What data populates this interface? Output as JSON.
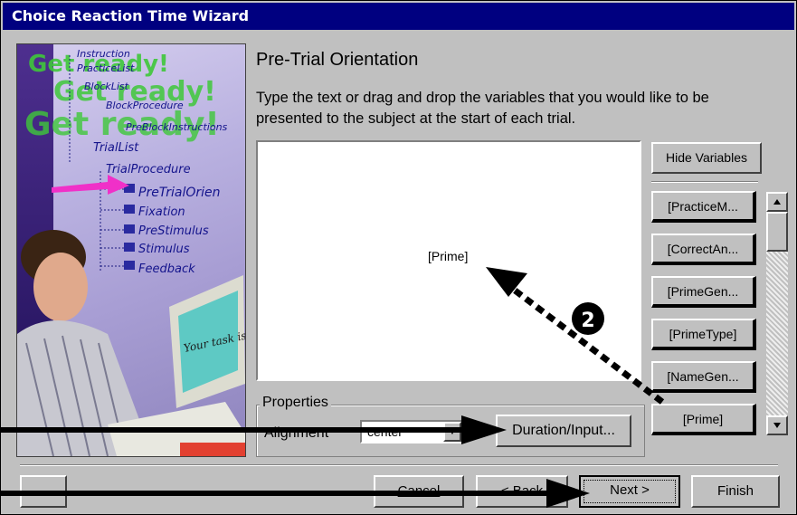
{
  "window": {
    "title": "Choice Reaction Time Wizard"
  },
  "illustration": {
    "tree_items": [
      "Instruction",
      "PracticeList",
      "BlockList",
      "BlockProcedure",
      "PreBlockInstructions",
      "TrialList",
      "TrialProcedure",
      "PreTrialOrien",
      "Fixation",
      "PreStimulus",
      "Stimulus",
      "Feedback"
    ],
    "get_ready": "Get ready!",
    "monitor_text": "Your task is..."
  },
  "main": {
    "heading": "Pre-Trial Orientation",
    "description": "Type the text or drag and drop the variables that you would like to be presented to the subject at the start of each trial.",
    "editor_text": "[Prime]"
  },
  "variables": {
    "hide_label": "Hide Variables",
    "items": [
      "[PracticeM...",
      "[CorrectAn...",
      "[PrimeGen...",
      "[PrimeType]",
      "[NameGen...",
      "[Prime]"
    ]
  },
  "properties": {
    "group_label": "Properties",
    "alignment_label": "Alignment",
    "alignment_value": "center",
    "duration_label": "Duration/Input..."
  },
  "footer": {
    "cancel_label": "Cancel",
    "back_label": "< Back",
    "next_label": "Next >",
    "finish_label": "Finish"
  },
  "annotation": {
    "marker": "❷"
  }
}
